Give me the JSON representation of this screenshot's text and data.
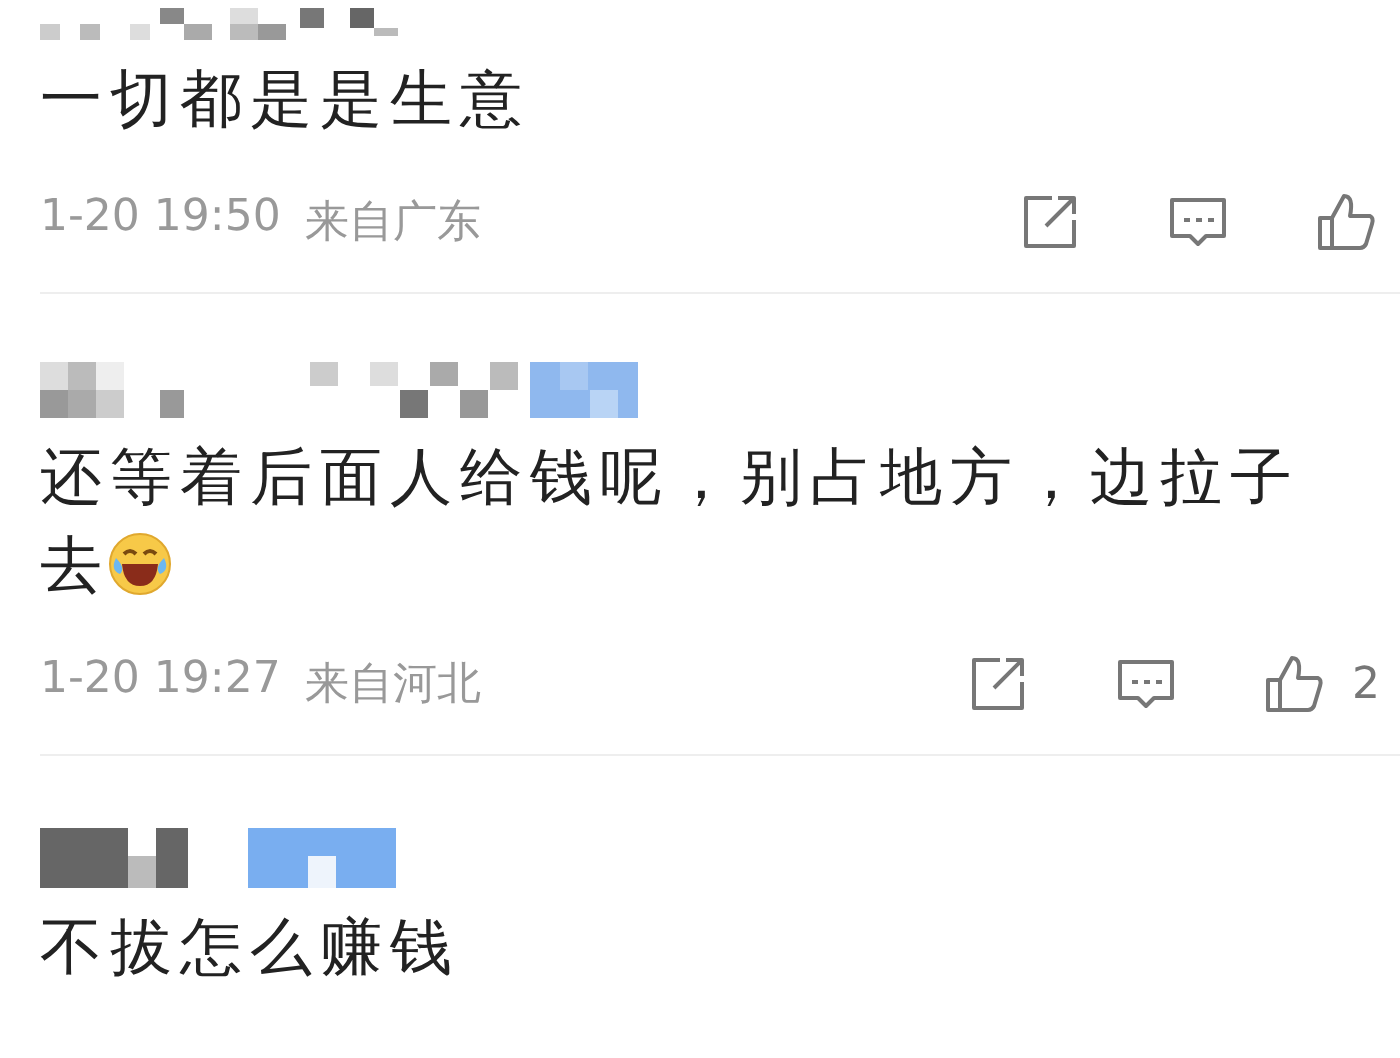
{
  "comments": [
    {
      "text": "一切都是是生意",
      "laughing_emoji": false,
      "time": "1-20 19:50",
      "location": "来自广东"
    },
    {
      "text": "还等着后面人给钱呢，别占地方，边拉子去",
      "laughing_emoji": true,
      "time": "1-20 19:27",
      "location": "来自河北",
      "like_count": "2"
    },
    {
      "text": "不拔怎么赚钱",
      "laughing_emoji": false
    }
  ]
}
